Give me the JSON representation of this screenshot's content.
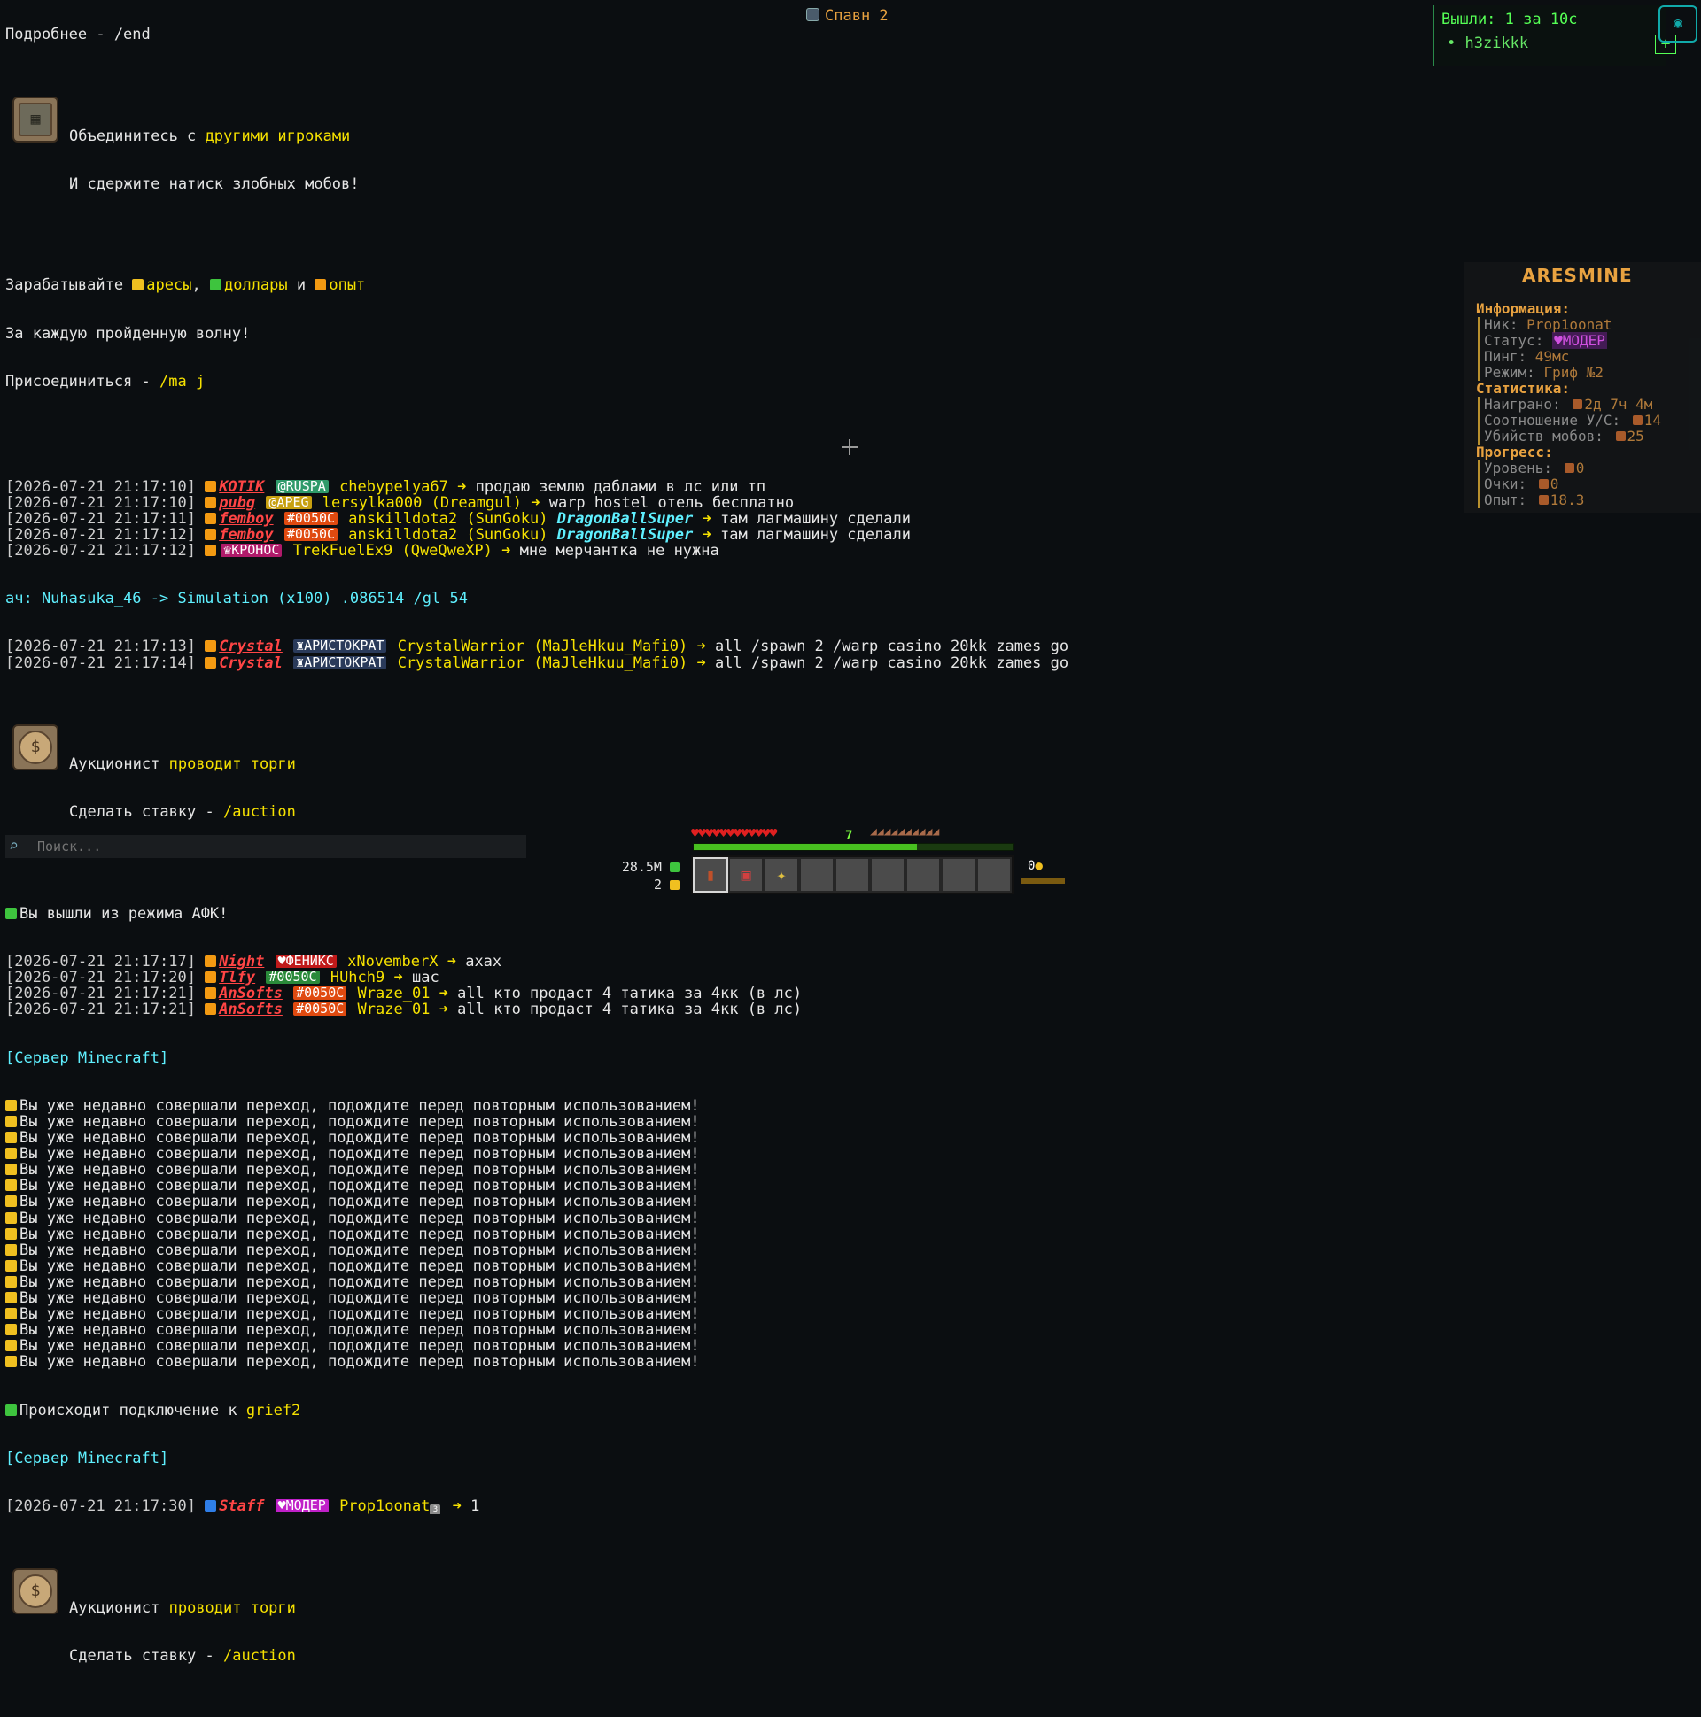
{
  "top_center": "Спавн 2",
  "exits": {
    "title": "Вышли: 1 за 10с",
    "user": "h3zikkk",
    "plus": "+"
  },
  "chat": {
    "header": "Подробнее - /end",
    "notif_creeper": {
      "line1_a": "Объединитесь с ",
      "line1_b": "другими игроками",
      "line2": "И сдержите натиск злобных мобов!"
    },
    "earn": {
      "a": "Зарабатывайте ",
      "b": "аресы",
      "c": ", ",
      "d": "доллары",
      "e": " и ",
      "f": "опыт"
    },
    "earn2": "За каждую пройденную волну!",
    "join": {
      "a": "Присоединиться - ",
      "b": "/ma j"
    },
    "messages1": [
      {
        "ts": "[2026-07-21 21:17:10]",
        "rank": "KOTIK",
        "badge": "@RUSPA",
        "badge_bg": "#2f9a6a",
        "name": "chebypelya67",
        "msg": "продаю землю даблами в лс или тп"
      },
      {
        "ts": "[2026-07-21 21:17:10]",
        "rank": "pubg",
        "badge": "@APEG",
        "badge_bg": "#c8a010",
        "name": "lersylka000 (Dreamgul)",
        "msg": "warp hostel отель бесплатно"
      },
      {
        "ts": "[2026-07-21 21:17:11]",
        "rank": "femboy",
        "badge": "#0050C",
        "badge_bg": "#e04a10",
        "name": "anskilldota2 (SunGoku)",
        "extra": "DragonBallSuper",
        "msg": "там лагмашину сделали"
      },
      {
        "ts": "[2026-07-21 21:17:12]",
        "rank": "femboy",
        "badge": "#0050C",
        "badge_bg": "#e04a10",
        "name": "anskilldota2 (SunGoku)",
        "extra": "DragonBallSuper",
        "msg": "там лагмашину сделали"
      },
      {
        "ts": "[2026-07-21 21:17:12]",
        "rank": "",
        "badge": "♛КРОНОС",
        "badge_bg": "#b01a6a",
        "name": "TrekFuelEx9 (QweQweXP)",
        "msg": "мне мерчантка не нужна"
      }
    ],
    "ach_line": "ач: Nuhasuka_46 -> Simulation (x100) .086514 /gl 54",
    "messages2": [
      {
        "ts": "[2026-07-21 21:17:13]",
        "rank": "Crystal",
        "badge": "♜АРИСТОКРАТ",
        "badge_bg": "#2a3a5a",
        "name": "CrystalWarrior (MaJleHkuu_Mafi0)",
        "msg": "all /spawn 2 /warp casino 20kk zames go"
      },
      {
        "ts": "[2026-07-21 21:17:14]",
        "rank": "Crystal",
        "badge": "♜АРИСТОКРАТ",
        "badge_bg": "#2a3a5a",
        "name": "CrystalWarrior (MaJleHkuu_Mafi0)",
        "msg": "all /spawn 2 /warp casino 20kk zames go"
      }
    ],
    "notif_auction": {
      "line1_a": "Аукционист ",
      "line1_b": "проводит торги",
      "line2_a": "Сделать ставку - ",
      "line2_b": "/auction"
    },
    "afk": "Вы вышли из режима АФК!",
    "messages3": [
      {
        "ts": "[2026-07-21 21:17:17]",
        "rank": "Night",
        "badge": "♥ФЕНИКС",
        "badge_bg": "#c01a1a",
        "name": "xNovemberX",
        "msg": "axax"
      },
      {
        "ts": "[2026-07-21 21:17:20]",
        "rank": "Tlfy",
        "badge": "#0050C",
        "badge_bg": "#2a8a3a",
        "name": "HUhch9",
        "msg": "шас"
      },
      {
        "ts": "[2026-07-21 21:17:21]",
        "rank": "AnSofts",
        "badge": "#0050C",
        "badge_bg": "#e04a10",
        "name": "Wraze_01",
        "msg": "all кто продаст 4 татика за 4кк (в лс)"
      },
      {
        "ts": "[2026-07-21 21:17:21]",
        "rank": "AnSofts",
        "badge": "#0050C",
        "badge_bg": "#e04a10",
        "name": "Wraze_01",
        "msg": "all кто продаст 4 татика за 4кк (в лс)"
      }
    ],
    "server_label": "[Сервер Minecraft]",
    "cooldown": "Вы уже недавно совершали переход, подождите перед повторным использованием!",
    "cooldown_count": 17,
    "connecting": {
      "a": "Происходит подключение к ",
      "b": "grief2"
    },
    "server_label2": "[Сервер Minecraft]",
    "staff_msg": {
      "ts": "[2026-07-21 21:17:30]",
      "rank": "Staff",
      "badge": "♥МОДЕР",
      "badge_bg": "#c020c8",
      "name": "Prop1oonat",
      "msg": "1"
    },
    "notif_auction2": {
      "line1_a": "Аукционист ",
      "line1_b": "проводит торги",
      "line2_a": "Сделать ставку - ",
      "line2_b": "/auction"
    }
  },
  "scoreboard": {
    "title": "ARESMINE",
    "info_h": "Информация:",
    "nick_l": "Ник: ",
    "nick_v": "Prop1oonat",
    "status_l": "Статус: ",
    "status_v": "♥МОДЕР",
    "ping_l": "Пинг: ",
    "ping_v": "49мс",
    "mode_l": "Режим: ",
    "mode_v": "Гриф №2",
    "stats_h": "Статистика:",
    "played_l": "Наиграно: ",
    "played_v": "2д 7ч 4м",
    "kd_l": "Соотношение У/С: ",
    "kd_v": "14",
    "mobs_l": "Убийств мобов: ",
    "mobs_v": "25",
    "prog_h": "Прогресс:",
    "level_l": "Уровень: ",
    "level_v": "0",
    "points_l": "Очки: ",
    "points_v": "0",
    "exp_l": "Опыт: ",
    "exp_v": "18.3"
  },
  "search": {
    "placeholder": "Поиск..."
  },
  "hud": {
    "xp_level": "7",
    "xp_fraction": 0.7,
    "money": "28.5M",
    "coins": "2",
    "offhand": "0"
  }
}
